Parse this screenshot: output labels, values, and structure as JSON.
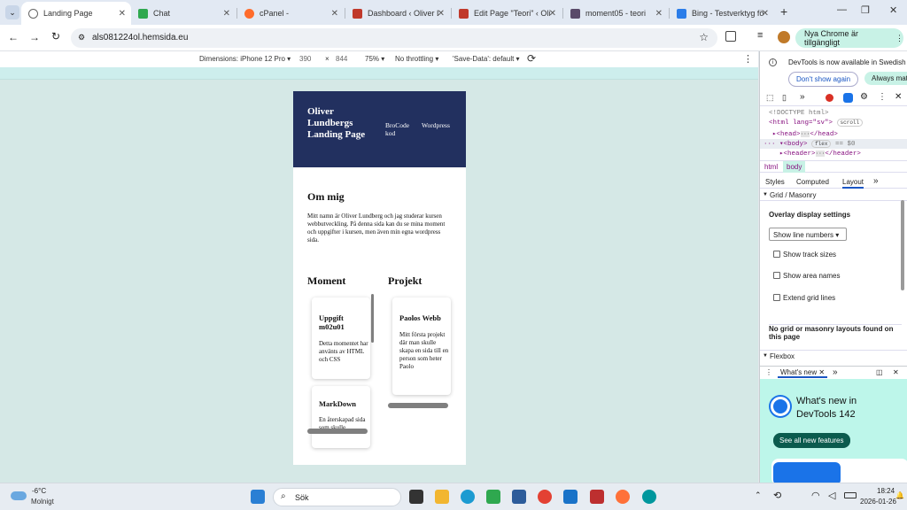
{
  "browser": {
    "tabs": [
      {
        "label": "Landing Page",
        "active": true
      },
      {
        "label": "Chat"
      },
      {
        "label": "cPanel -"
      },
      {
        "label": "Dashboard ‹ Oliver Lu"
      },
      {
        "label": "Edit Page \"Teori\" ‹ Oli"
      },
      {
        "label": "moment05 - teori"
      },
      {
        "label": "Bing - Testverktyg fö"
      }
    ],
    "url": "als081224ol.hemsida.eu",
    "update_label": "Nya Chrome är tillgängligt"
  },
  "device_toolbar": {
    "dimensions_label": "Dimensions: iPhone 12 Pro",
    "width": "390",
    "times": "×",
    "height": "844",
    "zoom": "75%",
    "throttling": "No throttling",
    "save_data": "'Save-Data': default"
  },
  "page": {
    "title": "Oliver Lundbergs Landing Page",
    "nav": [
      "BroCode kod",
      "Wordpress"
    ],
    "about": {
      "heading": "Om mig",
      "text": "Mitt namn är Oliver Lundberg och jag studerar kursen webbutveckling. På denna sida kan du se mina moment och uppgifter i kursen, men även min egna wordpress sida."
    },
    "moment": {
      "heading": "Moment",
      "cards": [
        {
          "title": "Uppgift m02u01",
          "text": "Detta momentet har använts av HTML och CSS"
        },
        {
          "title": "MarkDown",
          "text": "En återskapad sida som skulle"
        }
      ]
    },
    "projekt": {
      "heading": "Projekt",
      "cards": [
        {
          "title": "Paolos Webb",
          "text": "Mitt första projekt där man skulle skapa en sida till en person som heter Paolo"
        }
      ]
    }
  },
  "devtools": {
    "banner": "DevTools is now available in Swedish",
    "dont_show": "Don't show again",
    "always": "Always match",
    "dom": {
      "doctype": "<!DOCTYPE html>",
      "html_open": "<html lang=\"sv\">",
      "html_badge": "scroll",
      "head": "<head>",
      "head_close": "</head>",
      "body": "<body>",
      "body_badge": "flex",
      "body_eq": "== $0",
      "header": "<header>",
      "header_close": "</header>",
      "ellipsis": "···"
    },
    "breadcrumbs": [
      "html",
      "body"
    ],
    "subtabs": [
      "Styles",
      "Computed",
      "Layout"
    ],
    "grid_section": "Grid / Masonry",
    "overlay_heading": "Overlay display settings",
    "select_value": "Show line numbers",
    "checkboxes": [
      "Show track sizes",
      "Show area names",
      "Extend grid lines"
    ],
    "no_layouts": "No grid or masonry layouts found on this page",
    "flexbox_section": "Flexbox",
    "whatsnew_tab": "What's new",
    "whatsnew_title": "What's new in DevTools 142",
    "see_all": "See all new features"
  },
  "taskbar": {
    "temp": "-6°C",
    "weather": "Molnigt",
    "search": "Sök",
    "time": "18:24",
    "date": "2026-01-26"
  },
  "colors": {
    "header_bg": "#22305f",
    "accent": "#1a73e8",
    "viewport_bg": "#d5e8e6"
  }
}
